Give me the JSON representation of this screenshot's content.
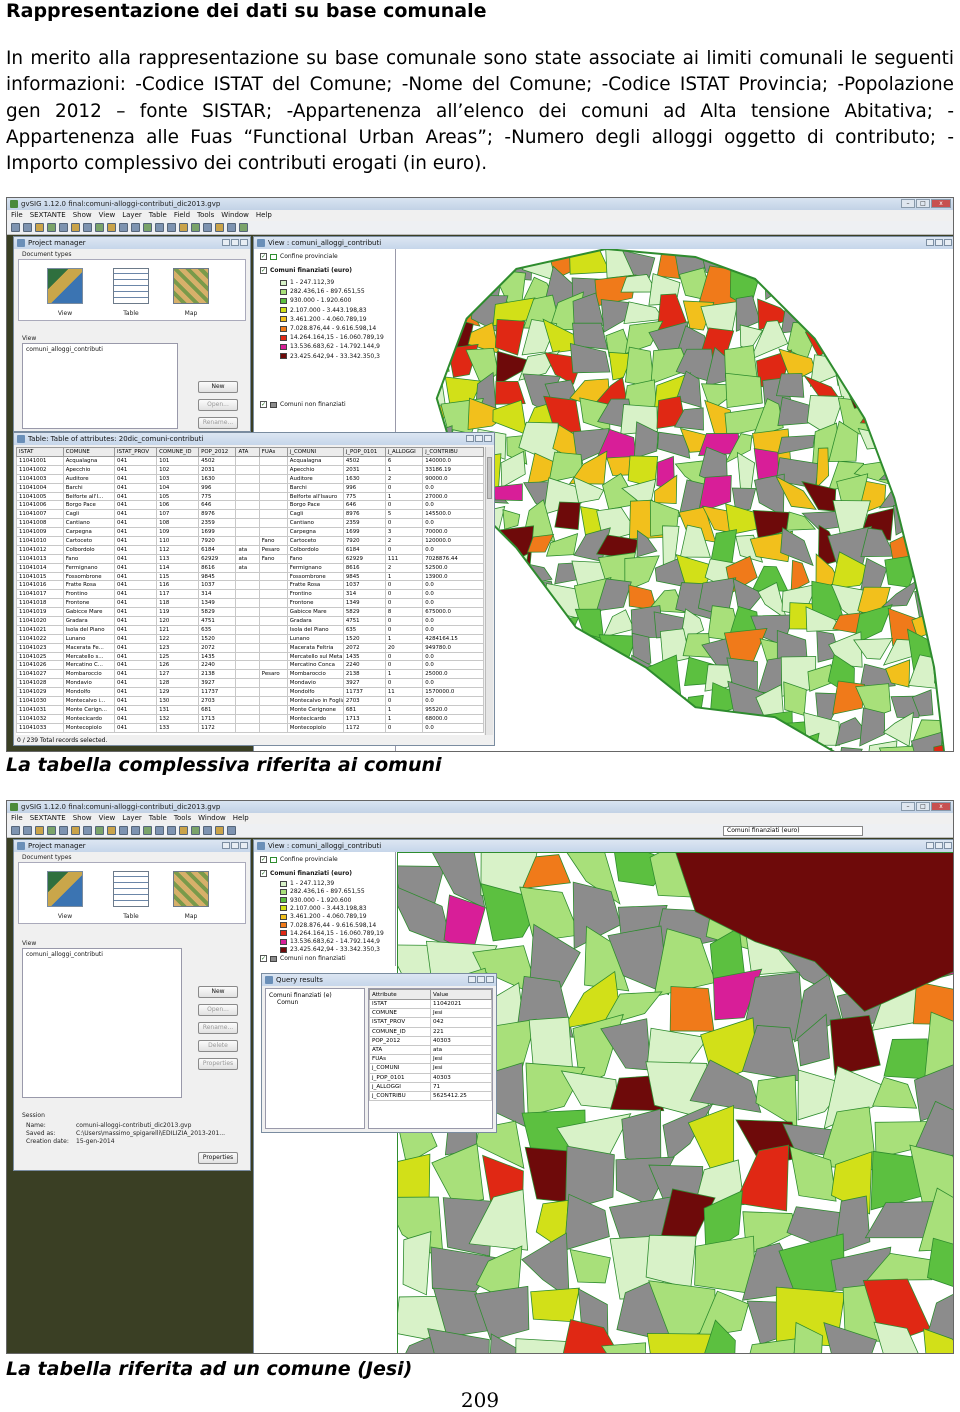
{
  "document": {
    "heading": "Rappresentazione dei dati su base comunale",
    "paragraph": "In merito alla rappresentazione su base comunale sono state associate ai limiti comunali le seguenti informazioni: -Codice ISTAT del Comune; -Nome del Comune; -Codice ISTAT Provincia; -Popolazione gen 2012 – fonte SISTAR; -Appartenenza all’elenco dei comuni ad Alta tensione Abitativa; -Appartenenza alle Fuas “Functional Urban Areas”; -Numero degli alloggi oggetto di contributo; -Importo complessivo dei contributi erogati (in euro).",
    "caption1": "La tabella complessiva riferita ai comuni",
    "caption2": "La tabella riferita ad un comune (Jesi)",
    "page_number": "209"
  },
  "app": {
    "title1": "gvSIG 1.12.0 final:comuni-alloggi-contributi_dic2013.gvp",
    "title2": "gvSIG 1.12.0 final:comuni-alloggi-contributi_dic2013.gvp",
    "menu1": [
      "File",
      "SEXTANTE",
      "Show",
      "View",
      "Layer",
      "Table",
      "Field",
      "Tools",
      "Window",
      "Help"
    ],
    "menu2": [
      "File",
      "SEXTANTE",
      "Show",
      "View",
      "Layer",
      "Table",
      "Tools",
      "Window",
      "Help"
    ],
    "layer_combo": "Comuni finanziati (euro)"
  },
  "project_manager": {
    "title": "Project manager",
    "document_types": "Document types",
    "doc_types": [
      "View",
      "Table",
      "Map"
    ],
    "view_label": "View",
    "view_item": "comuni_alloggi_contributi",
    "buttons": [
      "New",
      "Open...",
      "Rename...",
      "Delete",
      "Properties"
    ],
    "session": {
      "label": "Session",
      "name_label": "Name:",
      "name_value": "comuni-alloggi-contributi_dic2013.gvp",
      "saved_label": "Saved as:",
      "saved_value": "C:\\Users\\massimo_spigarelli\\EDILIZIA_2013-201...",
      "created_label": "Creation date:",
      "created_value": "15-gen-2014",
      "properties_button": "Properties"
    }
  },
  "view_window": {
    "title": "View : comuni_alloggi_contributi",
    "layers": {
      "confine": "Confine provinciale",
      "finanziati": "Comuni finanziati (euro)",
      "non_finanziati": "Comuni non finanziati"
    },
    "legend": [
      {
        "label": "1 - 247.112,39",
        "color": "#d8f2c8"
      },
      {
        "label": "282.436,16 - 897.651,55",
        "color": "#a8e07a"
      },
      {
        "label": "930.000 - 1.920.600",
        "color": "#5cc040"
      },
      {
        "label": "2.107.000 - 3.443.198,83",
        "color": "#d2e018"
      },
      {
        "label": "3.461.200 - 4.060.789,19",
        "color": "#f2c01c"
      },
      {
        "label": "7.028.876,44 - 9.616.598,14",
        "color": "#f07a1a"
      },
      {
        "label": "14.264.164,15 - 16.060.789,19",
        "color": "#e02814"
      },
      {
        "label": "13.536.683,62 - 14.792.144,9",
        "color": "#d81e98"
      },
      {
        "label": "23.425.642,94 - 33.342.350,3",
        "color": "#6e0a0a"
      }
    ],
    "non_financed_color": "#8c8c8c",
    "border_color": "#2e8c2e"
  },
  "attribute_table": {
    "title": "Table: Table of attributes: 20dic_comuni-contributi",
    "columns": [
      "ISTAT",
      "COMUNE",
      "ISTAT_PROV",
      "COMUNE_ID",
      "POP_2012",
      "ATA",
      "FUAs",
      "j_COMUNI",
      "j_POP_0101",
      "j_ALLOGGI",
      "j_CONTRIBU"
    ],
    "rows": [
      [
        "11041001",
        "Acqualagna",
        "041",
        "101",
        "4502",
        "",
        "",
        "Acqualagna",
        "4502",
        "6",
        "140000.0"
      ],
      [
        "11041002",
        "Apecchio",
        "041",
        "102",
        "2031",
        "",
        "",
        "Apecchio",
        "2031",
        "1",
        "33186.19"
      ],
      [
        "11041003",
        "Auditore",
        "041",
        "103",
        "1630",
        "",
        "",
        "Auditore",
        "1630",
        "2",
        "90000.0"
      ],
      [
        "11041004",
        "Barchi",
        "041",
        "104",
        "996",
        "",
        "",
        "Barchi",
        "996",
        "0",
        "0.0"
      ],
      [
        "11041005",
        "Belforte all'I...",
        "041",
        "105",
        "775",
        "",
        "",
        "Belforte all'Isauro",
        "775",
        "1",
        "27000.0"
      ],
      [
        "11041006",
        "Borgo Pace",
        "041",
        "106",
        "646",
        "",
        "",
        "Borgo Pace",
        "646",
        "0",
        "0.0"
      ],
      [
        "11041007",
        "Cagli",
        "041",
        "107",
        "8976",
        "",
        "",
        "Cagli",
        "8976",
        "5",
        "145500.0"
      ],
      [
        "11041008",
        "Cantiano",
        "041",
        "108",
        "2359",
        "",
        "",
        "Cantiano",
        "2359",
        "0",
        "0.0"
      ],
      [
        "11041009",
        "Carpegna",
        "041",
        "109",
        "1699",
        "",
        "",
        "Carpegna",
        "1699",
        "3",
        "70000.0"
      ],
      [
        "11041010",
        "Cartoceto",
        "041",
        "110",
        "7920",
        "",
        "Fano",
        "Cartoceto",
        "7920",
        "2",
        "120000.0"
      ],
      [
        "11041012",
        "Colbordolo",
        "041",
        "112",
        "6184",
        "ata",
        "Pesaro",
        "Colbordolo",
        "6184",
        "0",
        "0.0"
      ],
      [
        "11041013",
        "Fano",
        "041",
        "113",
        "62929",
        "ata",
        "Fano",
        "Fano",
        "62929",
        "111",
        "7028876.44"
      ],
      [
        "11041014",
        "Fermignano",
        "041",
        "114",
        "8616",
        "ata",
        "",
        "Fermignano",
        "8616",
        "2",
        "52500.0"
      ],
      [
        "11041015",
        "Fossombrone",
        "041",
        "115",
        "9845",
        "",
        "",
        "Fossombrone",
        "9845",
        "1",
        "13900.0"
      ],
      [
        "11041016",
        "Fratte Rosa",
        "041",
        "116",
        "1037",
        "",
        "",
        "Fratte Rosa",
        "1037",
        "0",
        "0.0"
      ],
      [
        "11041017",
        "Frontino",
        "041",
        "117",
        "314",
        "",
        "",
        "Frontino",
        "314",
        "0",
        "0.0"
      ],
      [
        "11041018",
        "Frontone",
        "041",
        "118",
        "1349",
        "",
        "",
        "Frontone",
        "1349",
        "0",
        "0.0"
      ],
      [
        "11041019",
        "Gabicce Mare",
        "041",
        "119",
        "5829",
        "",
        "",
        "Gabicce Mare",
        "5829",
        "8",
        "675000.0"
      ],
      [
        "11041020",
        "Gradara",
        "041",
        "120",
        "4751",
        "",
        "",
        "Gradara",
        "4751",
        "0",
        "0.0"
      ],
      [
        "11041021",
        "Isola del Piano",
        "041",
        "121",
        "635",
        "",
        "",
        "Isola del Piano",
        "635",
        "0",
        "0.0"
      ],
      [
        "11041022",
        "Lunano",
        "041",
        "122",
        "1520",
        "",
        "",
        "Lunano",
        "1520",
        "1",
        "4284164.15"
      ],
      [
        "11041023",
        "Macerata Fe...",
        "041",
        "123",
        "2072",
        "",
        "",
        "Macerata Feltria",
        "2072",
        "20",
        "949780.0"
      ],
      [
        "11041025",
        "Mercatello s...",
        "041",
        "125",
        "1435",
        "",
        "",
        "Mercatello sul Meta...",
        "1435",
        "0",
        "0.0"
      ],
      [
        "11041026",
        "Mercatino C...",
        "041",
        "126",
        "2240",
        "",
        "",
        "Mercatino Conca",
        "2240",
        "0",
        "0.0"
      ],
      [
        "11041027",
        "Mombaroccio",
        "041",
        "127",
        "2138",
        "",
        "Pesaro",
        "Mombaroccio",
        "2138",
        "1",
        "25000.0"
      ],
      [
        "11041028",
        "Mondavio",
        "041",
        "128",
        "3927",
        "",
        "",
        "Mondavio",
        "3927",
        "0",
        "0.0"
      ],
      [
        "11041029",
        "Mondolfo",
        "041",
        "129",
        "11737",
        "",
        "",
        "Mondolfo",
        "11737",
        "11",
        "1570000.0"
      ],
      [
        "11041030",
        "Montecalvo i...",
        "041",
        "130",
        "2703",
        "",
        "",
        "Montecalvo in Foglia",
        "2703",
        "0",
        "0.0"
      ],
      [
        "11041031",
        "Monte Cerign...",
        "041",
        "131",
        "681",
        "",
        "",
        "Monte Cerignone",
        "681",
        "1",
        "95520.0"
      ],
      [
        "11041032",
        "Montecicardo",
        "041",
        "132",
        "1713",
        "",
        "",
        "Montecicardo",
        "1713",
        "1",
        "68000.0"
      ],
      [
        "11041033",
        "Montecopiolo",
        "041",
        "133",
        "1172",
        "",
        "",
        "Montecopiolo",
        "1172",
        "0",
        "0.0"
      ]
    ],
    "status": "0 / 239 Total records selected."
  },
  "query_results": {
    "title": "Query results",
    "tree_root": "Comuni finanziati (e)",
    "tree_child": "Comun",
    "columns": [
      "Attribute",
      "Value"
    ],
    "rows": [
      [
        "ISTAT",
        "11042021"
      ],
      [
        "COMUNE",
        "Jesi"
      ],
      [
        "ISTAT_PROV",
        "042"
      ],
      [
        "COMUNE_ID",
        "221"
      ],
      [
        "POP_2012",
        "40303"
      ],
      [
        "ATA",
        "ata"
      ],
      [
        "FUAs",
        "Jesi"
      ],
      [
        "j_COMUNI",
        "Jesi"
      ],
      [
        "j_POP_0101",
        "40303"
      ],
      [
        "j_ALLOGGI",
        "71"
      ],
      [
        "j_CONTRIBU",
        "5625412.25"
      ]
    ]
  }
}
